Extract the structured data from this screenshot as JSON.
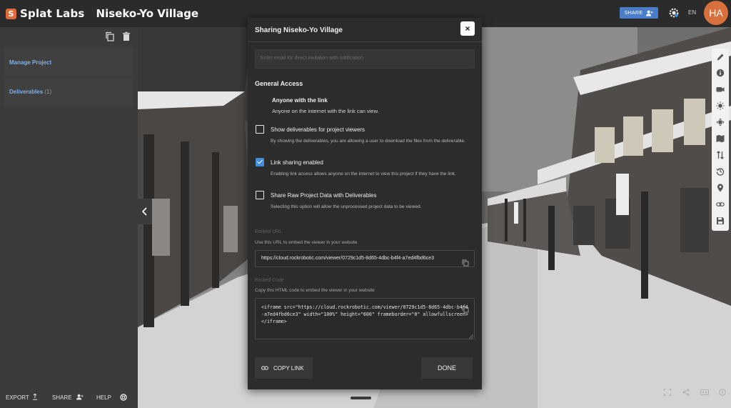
{
  "brand": {
    "logo_letter": "S",
    "name": "Splat Labs"
  },
  "project": {
    "title": "Niseko-Yo Village"
  },
  "topbar": {
    "share_label": "SHARE",
    "language": "EN",
    "avatar_initials": "HA"
  },
  "sidebar": {
    "items": [
      {
        "label": "Manage Project",
        "count": ""
      },
      {
        "label": "Deliverables",
        "count": "(1)"
      }
    ],
    "bottom": {
      "export_label": "EXPORT",
      "share_label": "SHARE",
      "help_label": "HELP"
    }
  },
  "modal": {
    "title": "Sharing Niseko-Yo Village",
    "close_label": "×",
    "invite_placeholder": "Enter email for direct invitation with notification",
    "general_access_heading": "General Access",
    "access_title": "Anyone with the link",
    "access_desc": "Anyone on the internet with the link can view.",
    "options": [
      {
        "label": "Show deliverables for project viewers",
        "checked": false,
        "desc": "By showing the deliverables, you are allowing a user to download the files from the deliverable."
      },
      {
        "label": "Link sharing enabled",
        "checked": true,
        "desc": "Enabling link access allows anyone on the internet to view this project if they have the link."
      },
      {
        "label": "Share Raw Project Data with Deliverables",
        "checked": false,
        "desc": "Selecting this option will allow the unprocessed project data to be viewed."
      }
    ],
    "embed_url_label": "Embed URL",
    "embed_url_desc": "Use this URL to embed the viewer in your website",
    "embed_url": "https://cloud.rockrobotic.com/viewer/0729c1d5-8d65-4dbc-b4f4-a7ed4fbd6ce3",
    "embed_code_label": "Embed Code",
    "embed_code_desc": "Copy this HTML code to embed the viewer in your website",
    "embed_code": "<iframe src=\"https://cloud.rockrobotic.com/viewer/0729c1d5-8d65-4dbc-b4f4-a7ed4fbd6ce3\" width=\"100%\" height=\"600\" frameborder=\"0\" allowfullscreen></iframe>",
    "copy_link_label": "COPY LINK",
    "done_label": "DONE"
  },
  "toolbar": {
    "icons": [
      "pencil-icon",
      "info-icon",
      "camera-icon",
      "brightness-icon",
      "move-icon",
      "map-icon",
      "swap-icon",
      "history-icon",
      "location-pin-icon",
      "link-icon",
      "save-icon"
    ]
  },
  "colors": {
    "accent": "#4a7ec9",
    "avatar": "#d8703e",
    "checkbox": "#3f8ed6",
    "link": "#7fb0e6",
    "brand": "#e06a3a"
  }
}
